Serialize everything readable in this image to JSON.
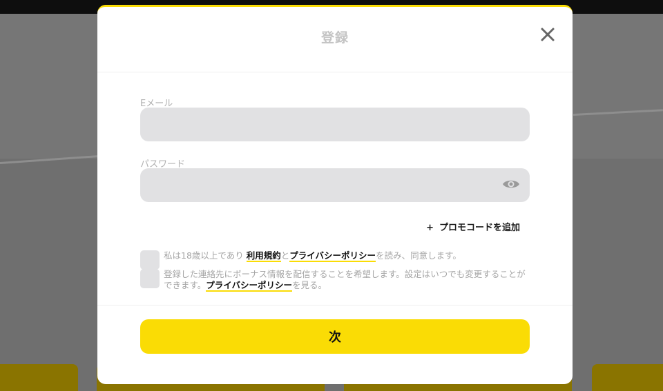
{
  "modal": {
    "title": "登録",
    "close_icon": "close-icon"
  },
  "form": {
    "email": {
      "label": "Eメール",
      "value": "",
      "placeholder": ""
    },
    "password": {
      "label": "パスワード",
      "value": "",
      "placeholder": "",
      "toggle_icon": "eye-icon"
    },
    "promo": {
      "plus": "+",
      "label": "プロモコードを追加"
    },
    "consent_age": {
      "text_before": "私は18歳以上であり ",
      "terms_link": "利用規約",
      "text_middle": "と",
      "privacy_link": "プライバシーポリシー",
      "text_after": "を読み、同意します。"
    },
    "consent_marketing": {
      "text_before": "登録した連絡先にボーナス情報を配信することを希望します。設定はいつでも変更することができます。",
      "privacy_link": "プライバシーポリシー",
      "text_after": "を見る。"
    },
    "submit_label": "次"
  },
  "colors": {
    "accent": "#fadc05",
    "input_bg": "#e1e1e3",
    "overlay": "#6f6f6f",
    "title": "#c4c4c4"
  }
}
